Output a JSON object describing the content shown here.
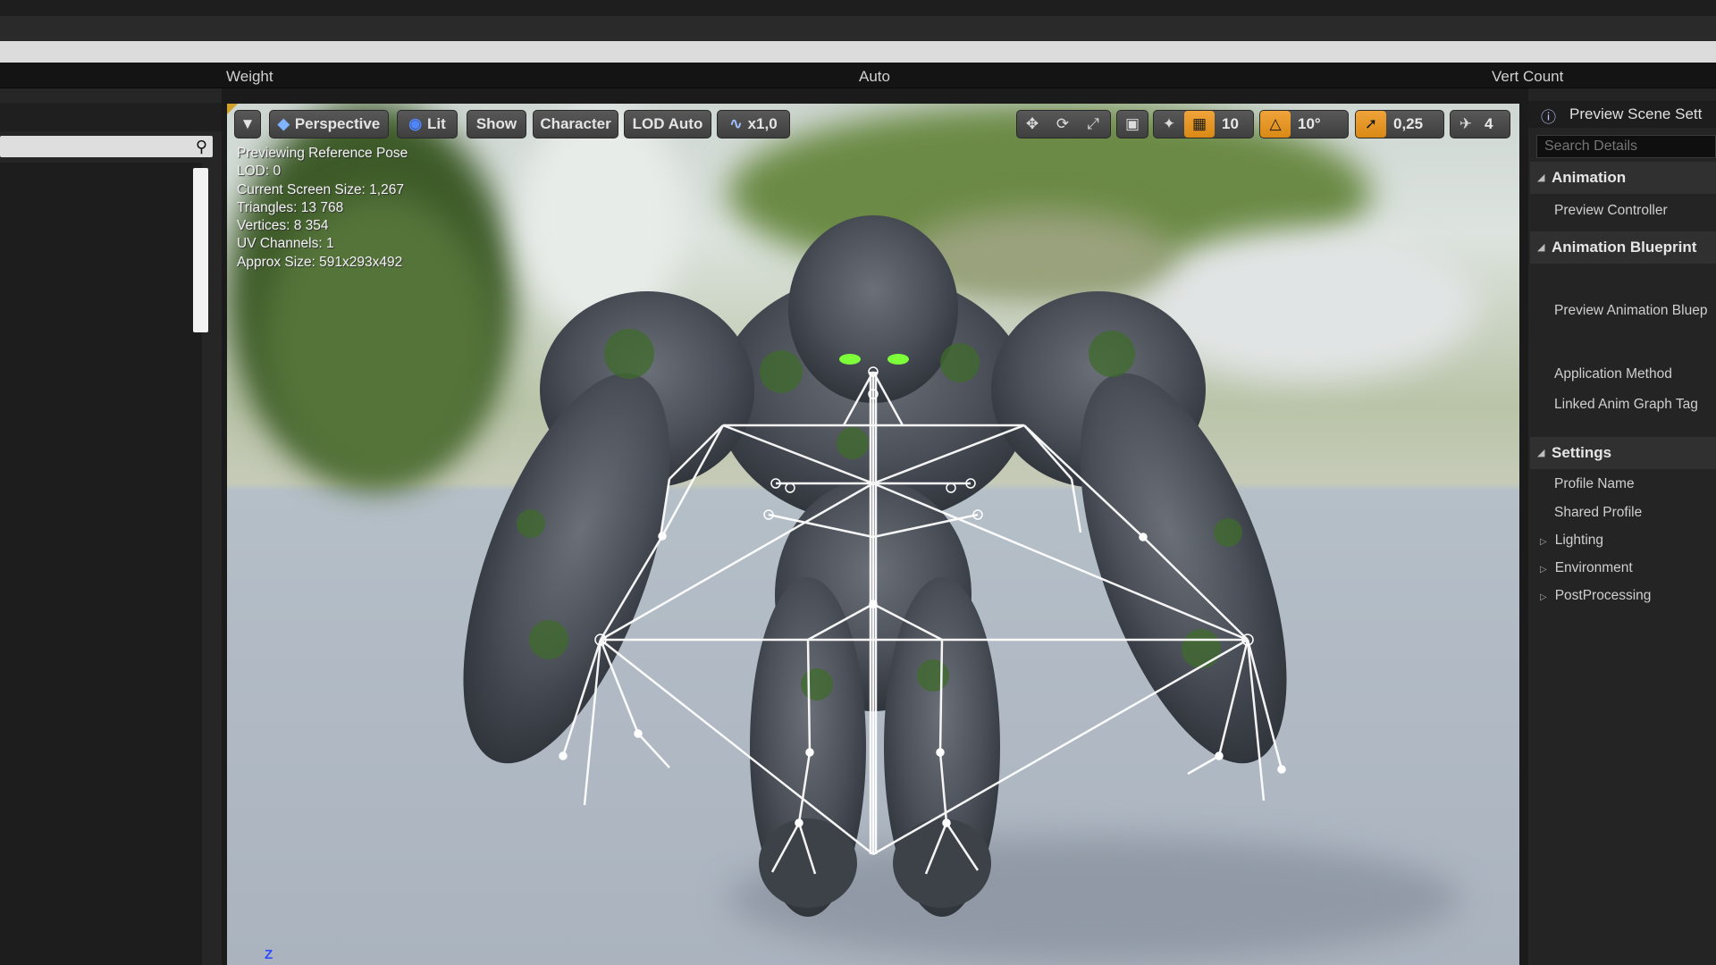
{
  "columns": {
    "weight": "Weight",
    "auto": "Auto",
    "vert_count": "Vert Count"
  },
  "viewport": {
    "toolbar": {
      "menu_icon": "chevron-down-icon",
      "perspective": "Perspective",
      "lit": "Lit",
      "show": "Show",
      "character": "Character",
      "lod": "LOD Auto",
      "speed": "x1,0",
      "grid_snap": "10",
      "rotation_snap": "10°",
      "scale_snap": "0,25",
      "camera_speed": "4"
    },
    "stats": {
      "line1": "Previewing Reference Pose",
      "line2": "LOD: 0",
      "line3": "Current Screen Size: 1,267",
      "line4": "Triangles: 13 768",
      "line5": "Vertices: 8 354",
      "line6": "UV Channels: 1",
      "line7": "Approx Size: 591x293x492"
    },
    "axis_label": "Z",
    "accent_color": "#e6971c"
  },
  "details": {
    "tab_title": "Preview Scene Sett",
    "search_placeholder": "Search Details",
    "sections": {
      "animation": "Animation",
      "preview_controller": "Preview Controller",
      "animation_blueprint": "Animation Blueprint",
      "preview_anim_bp": "Preview Animation Bluep",
      "application_method": "Application Method",
      "linked_anim_graph_tag": "Linked Anim Graph Tag",
      "settings": "Settings",
      "profile_name": "Profile Name",
      "shared_profile": "Shared Profile",
      "lighting": "Lighting",
      "environment": "Environment",
      "postprocessing": "PostProcessing"
    }
  }
}
